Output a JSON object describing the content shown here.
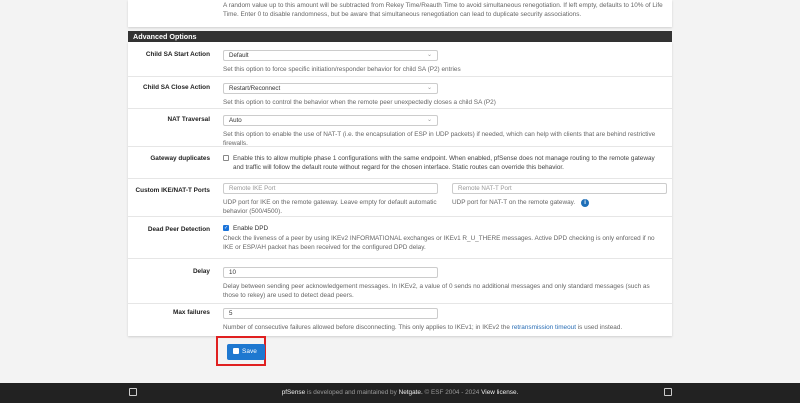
{
  "top_help": "A random value up to this amount will be subtracted from Rekey Time/Reauth Time to avoid simultaneous renegotiation. If left empty, defaults to 10% of Life Time. Enter 0 to disable randomness, but be aware that simultaneous renegotiation can lead to duplicate security associations.",
  "section_title": "Advanced Options",
  "child_sa_start": {
    "label": "Child SA Start Action",
    "value": "Default",
    "help": "Set this option to force specific initiation/responder behavior for child SA (P2) entries"
  },
  "child_sa_close": {
    "label": "Child SA Close Action",
    "value": "Restart/Reconnect",
    "help": "Set this option to control the behavior when the remote peer unexpectedly closes a child SA (P2)"
  },
  "nat_traversal": {
    "label": "NAT Traversal",
    "value": "Auto",
    "help": "Set this option to enable the use of NAT-T (i.e. the encapsulation of ESP in UDP packets) if needed, which can help with clients that are behind restrictive firewalls."
  },
  "gateway_duplicates": {
    "label": "Gateway duplicates",
    "checked": false,
    "text": "Enable this to allow multiple phase 1 configurations with the same endpoint. When enabled, pfSense does not manage routing to the remote gateway and traffic will follow the default route without regard for the chosen interface. Static routes can override this behavior."
  },
  "custom_ports": {
    "label": "Custom IKE/NAT-T Ports",
    "ike_placeholder": "Remote IKE Port",
    "ike_help": "UDP port for IKE on the remote gateway. Leave empty for default automatic behavior (500/4500).",
    "natt_placeholder": "Remote NAT-T Port",
    "natt_help": "UDP port for NAT-T on the remote gateway.",
    "info_icon": "i"
  },
  "dpd": {
    "label": "Dead Peer Detection",
    "checked": true,
    "check_label": "Enable DPD",
    "help": "Check the liveness of a peer by using IKEv2 INFORMATIONAL exchanges or IKEv1 R_U_THERE messages. Active DPD checking is only enforced if no IKE or ESP/AH packet has been received for the configured DPD delay."
  },
  "delay": {
    "label": "Delay",
    "value": "10",
    "help": "Delay between sending peer acknowledgement messages. In IKEv2, a value of 0 sends no additional messages and only standard messages (such as those to rekey) are used to detect dead peers."
  },
  "max_failures": {
    "label": "Max failures",
    "value": "5",
    "help_pre": "Number of consecutive failures allowed before disconnecting. This only applies to IKEv1; in IKEv2 the ",
    "help_link": "retransmission timeout",
    "help_post": " is used instead."
  },
  "save_label": "Save",
  "footer": {
    "brand": "pfSense",
    "mid": " is developed and maintained by ",
    "company": "Netgate.",
    "copy": " © ESF 2004 - 2024 ",
    "license": "View license."
  }
}
